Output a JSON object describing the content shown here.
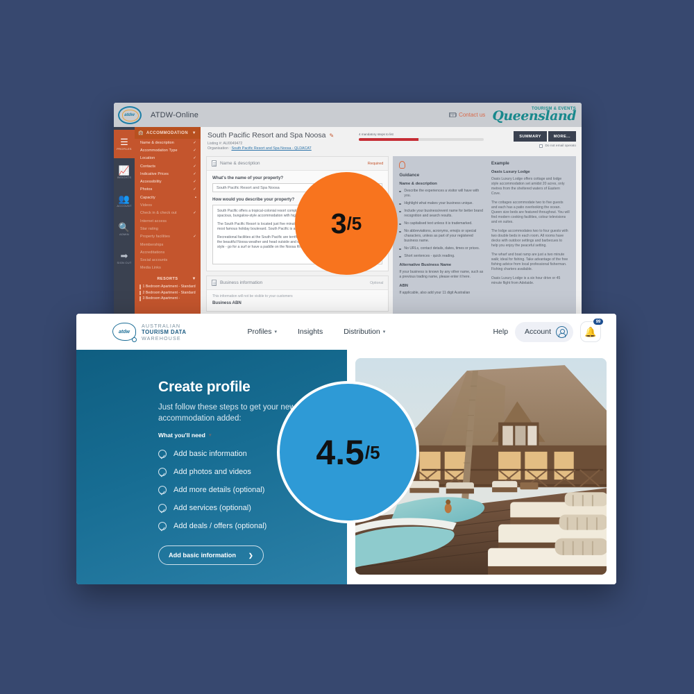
{
  "background_color": "#37486f",
  "badges": {
    "orange": {
      "value": "3",
      "denominator": "/5",
      "color": "#f8741e"
    },
    "blue": {
      "value": "4.5",
      "denominator": "/5",
      "color": "#2e9ad6"
    }
  },
  "atdw_online": {
    "window_title": "ATDW-Online",
    "logo_text": "atdw",
    "contact_us": "Contact us",
    "partner_logo": {
      "line1": "TOURISM & EVENTS",
      "line2": "Queensland"
    },
    "icon_rail": [
      {
        "label": "PROFILES",
        "icon": "list-icon",
        "active": true
      },
      {
        "label": "INSIGHTS",
        "icon": "chart-monitor-icon",
        "active": false
      },
      {
        "label": "ACCOUNT",
        "icon": "people-icon",
        "active": false
      },
      {
        "label": "ADMIN",
        "icon": "search-icon",
        "active": false
      },
      {
        "label": "SIGN OUT",
        "icon": "logout-icon",
        "active": false
      }
    ],
    "nav_header": "ACCOMMODATION",
    "nav_items": [
      {
        "label": "Name & description",
        "state": "tick",
        "dim": false
      },
      {
        "label": "Accommodation Type",
        "state": "tick",
        "dim": false
      },
      {
        "label": "Location",
        "state": "tick",
        "dim": false
      },
      {
        "label": "Contacts",
        "state": "tick",
        "dim": false
      },
      {
        "label": "Indicative Prices",
        "state": "tick",
        "dim": false
      },
      {
        "label": "Accessibility",
        "state": "tick",
        "dim": false
      },
      {
        "label": "Photos",
        "state": "tick",
        "dim": false
      },
      {
        "label": "Capacity",
        "state": "dot",
        "dim": false
      },
      {
        "label": "Videos",
        "state": "none",
        "dim": true
      },
      {
        "label": "Check in & check out",
        "state": "tick",
        "dim": true
      },
      {
        "label": "Internet access",
        "state": "none",
        "dim": true
      },
      {
        "label": "Star rating",
        "state": "none",
        "dim": true
      },
      {
        "label": "Property facilities",
        "state": "tick",
        "dim": true
      },
      {
        "label": "Memberships",
        "state": "none",
        "dim": true
      },
      {
        "label": "Accreditations",
        "state": "none",
        "dim": true
      },
      {
        "label": "Social accounts",
        "state": "none",
        "dim": true
      },
      {
        "label": "Media Links",
        "state": "none",
        "dim": true
      }
    ],
    "resorts_header": "RESORTS",
    "resorts": [
      "1 Bedroom Apartment - Standard",
      "2 Bedroom Apartment - Standard",
      "3 Bedroom Apartment -"
    ],
    "listing": {
      "title": "South Pacific Resort and Spa Noosa",
      "listing_number": "Listing #: AU0049472",
      "organisation_label": "Organisation :",
      "organisation_link": "South Pacific Resort and Spa Noosa - QLDACAT"
    },
    "progress": {
      "label": "4 mandatory steps to list",
      "percent": 48
    },
    "buttons": {
      "summary": "SUMMARY",
      "more": "MORE..."
    },
    "do_not_email": "Do not email operato",
    "form_card": {
      "title": "Name & description",
      "badge": "Required",
      "q1": "What's the name of your property?",
      "a1": "South Pacific Resort and Spa Noosa",
      "q2": "How would you describe your property?",
      "a2_p1": "South Pacific offers a tropical-colonial resort complex set in landscaped gardens. The resort features spacious, bungalow-style accommodation with high-pitched roofs and spacious shuttered verandahs.",
      "a2_p2": "The South Pacific Resort is located just five minutes drive from Hastings Street, the Sunshine Coast's most famous holiday boulevard. South Pacific is also home to the Noosa Health Spa.",
      "a2_p3": "Recreational facilities at the South Pacific are terrific for both adults and children. Take advantage of the beautiful Noosa weather and head outside and enjoy a game of tennis. Or if water is more your style - go for a surf or have a paddle on the Noosa River."
    },
    "business_card": {
      "title": "Business information",
      "badge": "Optional",
      "note": "This information will not be visible to your customers",
      "field_label": "Business ABN"
    },
    "guidance": {
      "heading": "Guidance",
      "subheading": "Name & description",
      "bullets": [
        "Describe the experiences a visitor will have with you.",
        "Highlight what makes your business unique.",
        "Include your business/event name for better brand recognition and search results.",
        "No capitalised text unless it is trademarked.",
        "No abbreviations, acronyms, emojis or special characters, unless as part of your registered business name.",
        "No URLs, contact details, dates, times or prices.",
        "Short sentences - quick reading."
      ],
      "alt_name_heading": "Alternative Business Name",
      "alt_name_text": "If your business is known by any other name, such as a previous trading name, please enter it here.",
      "abn_heading": "ABN",
      "abn_text": "If applicable, also add your 11 digit Australian"
    },
    "example": {
      "heading": "Example",
      "subheading": "Oasis Luxury Lodge",
      "paragraphs": [
        "Oasis Luxury Lodge offers cottage and lodge style accommodation set amidst 20 acres, only metres from the sheltered waters of Eastern Cove.",
        "The cottages accommodate two to five guests and each has a patio overlooking the ocean. Queen size beds are featured throughout. You will find modern cooking facilities, colour televisions and en suites.",
        "The lodge accommodates two to four guests with two double beds in each room. All rooms have decks with outdoor settings and barbecues to help you enjoy the peaceful setting.",
        "The wharf and boat ramp are just a two minute walk; ideal for fishing. Take advantage of the free fishing advice from local professional fisherman. Fishing charters available.",
        "Oasis Luxury Lodge is a six hour drive or 45 minute flight from Adelaide."
      ]
    }
  },
  "create_profile": {
    "brand": {
      "line1": "AUSTRALIAN",
      "line2": "TOURISM DATA",
      "line3": "WAREHOUSE",
      "mark_text": "atdw"
    },
    "nav": [
      {
        "label": "Profiles",
        "has_chevron": true
      },
      {
        "label": "Insights",
        "has_chevron": false
      },
      {
        "label": "Distribution",
        "has_chevron": true
      }
    ],
    "help_label": "Help",
    "account_label": "Account",
    "notification_count": "99",
    "heading": "Create profile",
    "subheading": "Just follow these steps to get your new accommodation added:",
    "what_youll_need": "What you'll need",
    "steps": [
      "Add basic information",
      "Add photos and videos",
      "Add more details (optional)",
      "Add services (optional)",
      "Add deals / offers (optional)"
    ],
    "cta_label": "Add basic information",
    "photo_alt": "tropical resort lodge with swimming pool, palm tree and sun loungers"
  }
}
